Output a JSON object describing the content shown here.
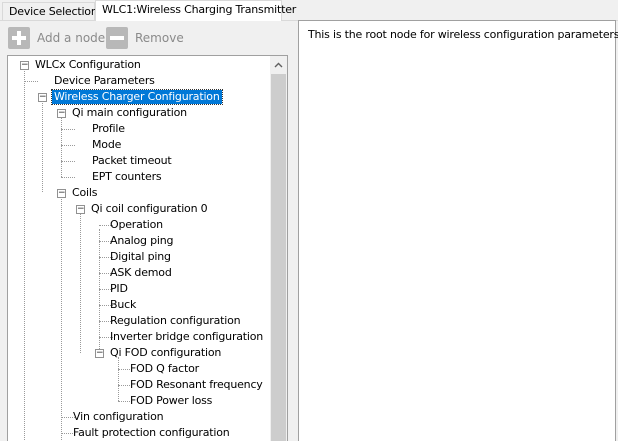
{
  "tabs": [
    {
      "label": "Device Selection",
      "active": false
    },
    {
      "label": "WLC1:Wireless Charging Transmitter",
      "active": true
    }
  ],
  "toolbar": {
    "add_label": "Add a node",
    "add_icon": "plus-icon",
    "remove_label": "Remove",
    "remove_icon": "minus-icon"
  },
  "tree": {
    "root": "WLCx Configuration",
    "device_parameters": "Device Parameters",
    "wireless_charger_configuration": "Wireless Charger Configuration",
    "qi_main_configuration": "Qi main configuration",
    "profile": "Profile",
    "mode": "Mode",
    "packet_timeout": "Packet timeout",
    "ept_counters": "EPT counters",
    "coils": "Coils",
    "qi_coil_configuration_0": "Qi coil configuration 0",
    "operation": "Operation",
    "analog_ping": "Analog ping",
    "digital_ping": "Digital ping",
    "ask_demod": "ASK demod",
    "pid": "PID",
    "buck": "Buck",
    "regulation_configuration": "Regulation configuration",
    "inverter_bridge_configuration": "Inverter bridge configuration",
    "qi_fod_configuration": "Qi FOD configuration",
    "fod_q_factor": "FOD Q factor",
    "fod_resonant_frequency": "FOD Resonant frequency",
    "fod_power_loss": "FOD Power loss",
    "vin_configuration": "Vin configuration",
    "fault_protection_configuration": "Fault protection configuration"
  },
  "description": "This is the root node for wireless configuration parameters",
  "colors": {
    "selection": "#0078d7",
    "window_bg": "#f0f0f0"
  }
}
